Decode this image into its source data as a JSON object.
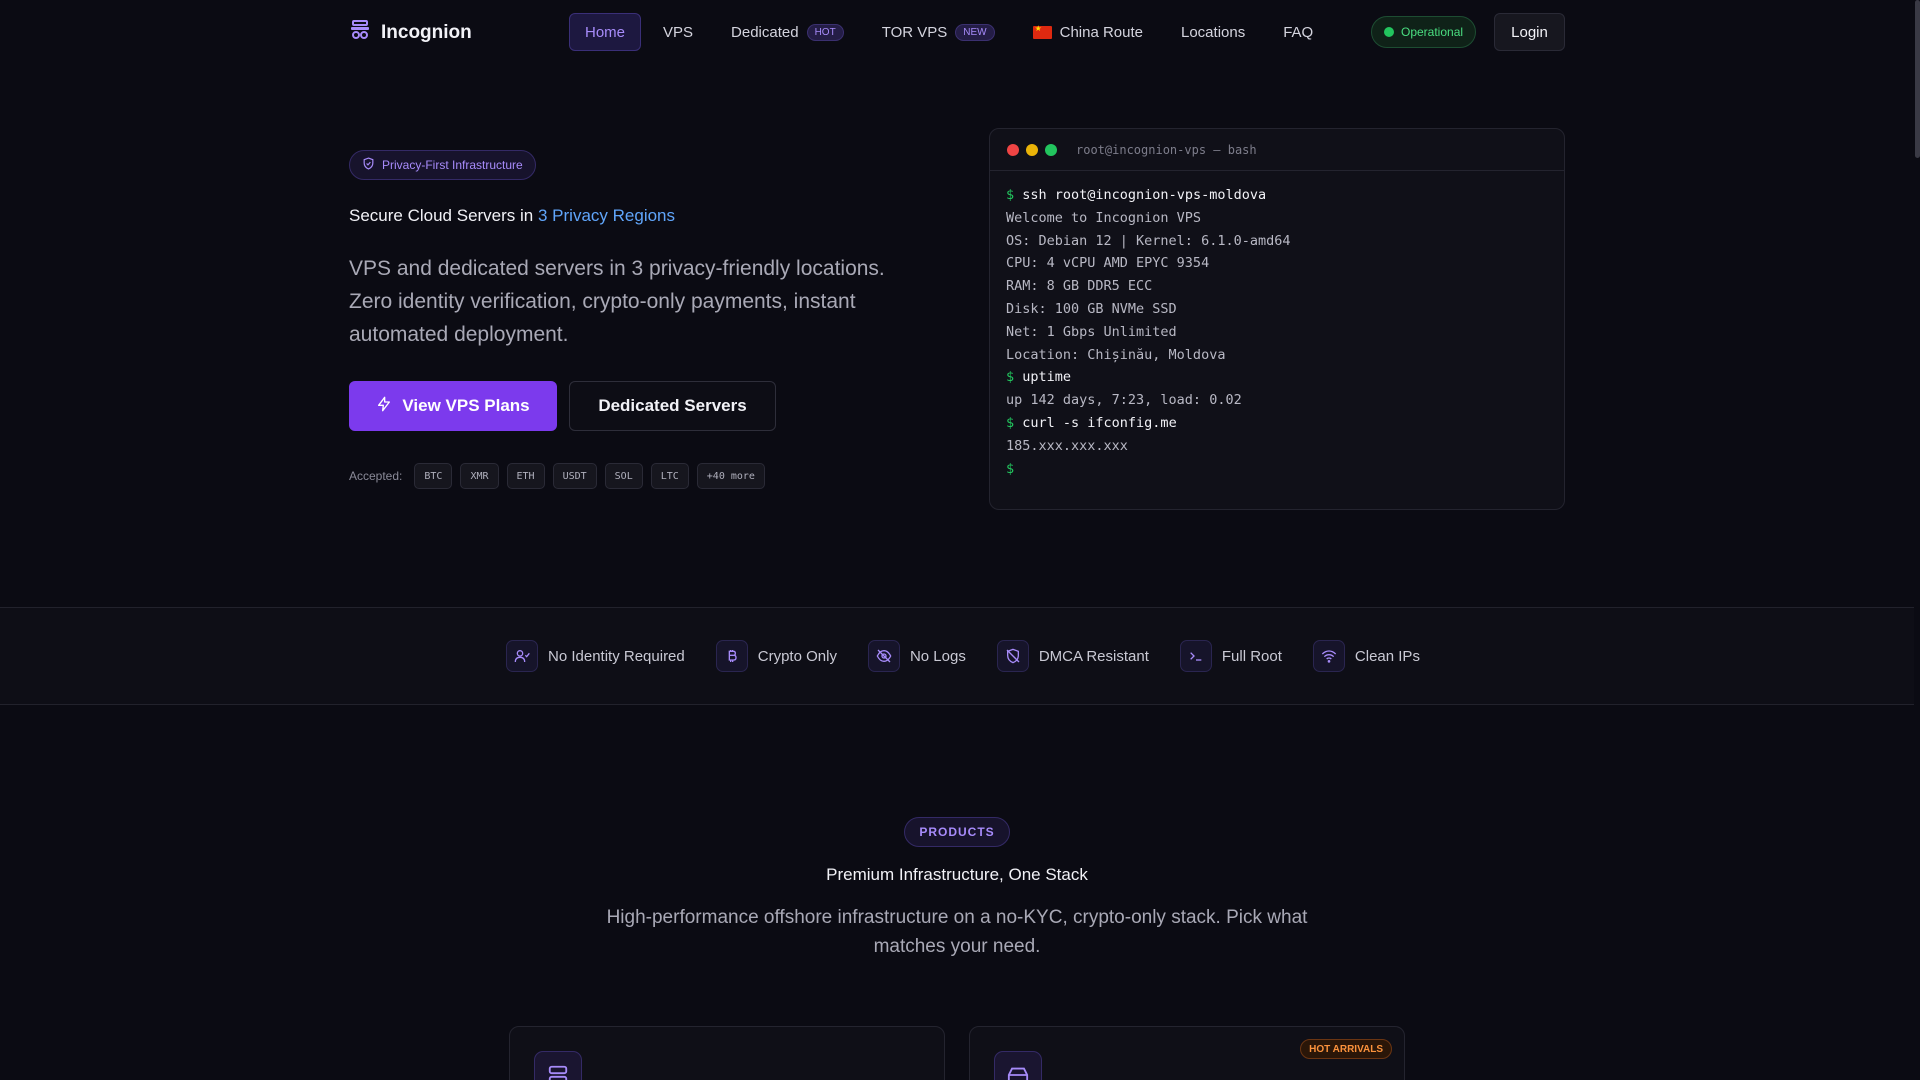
{
  "brand": {
    "name": "Incognion"
  },
  "nav": {
    "items": [
      {
        "label": "Home",
        "active": true
      },
      {
        "label": "VPS"
      },
      {
        "label": "Dedicated",
        "badge": "HOT"
      },
      {
        "label": "TOR VPS",
        "badge": "NEW"
      },
      {
        "label": "China Route",
        "flag": "CN"
      },
      {
        "label": "Locations"
      },
      {
        "label": "FAQ"
      }
    ],
    "status": "Operational",
    "login": "Login"
  },
  "hero": {
    "pill": "Privacy-First Infrastructure",
    "title_prefix": "Secure Cloud Servers in",
    "title_highlight": "3 Privacy Regions",
    "description": "VPS and dedicated servers in 3 privacy-friendly locations. Zero identity verification, crypto-only payments, instant automated deployment.",
    "primary_button": "View VPS Plans",
    "secondary_button": "Dedicated Servers",
    "accepted_label": "Accepted:",
    "coins": [
      "BTC",
      "XMR",
      "ETH",
      "USDT",
      "SOL",
      "LTC",
      "+40 more"
    ]
  },
  "terminal": {
    "title": "root@incognion-vps — bash",
    "lines": [
      {
        "type": "cmd",
        "text": "ssh root@incognion-vps-moldova"
      },
      {
        "type": "out",
        "text": "Welcome to Incognion VPS"
      },
      {
        "type": "out",
        "text": "OS: Debian 12 | Kernel: 6.1.0-amd64"
      },
      {
        "type": "out",
        "text": "CPU: 4 vCPU AMD EPYC 9354"
      },
      {
        "type": "out",
        "text": "RAM: 8 GB DDR5 ECC"
      },
      {
        "type": "out",
        "text": "Disk: 100 GB NVMe SSD"
      },
      {
        "type": "out",
        "text": "Net: 1 Gbps Unlimited"
      },
      {
        "type": "out",
        "text": "Location: Chișinău, Moldova"
      },
      {
        "type": "cmd",
        "text": "uptime"
      },
      {
        "type": "out",
        "text": "up 142 days, 7:23, load: 0.02"
      },
      {
        "type": "cmd",
        "text": "curl -s ifconfig.me"
      },
      {
        "type": "out",
        "text": "185.xxx.xxx.xxx"
      },
      {
        "type": "cmd",
        "text": ""
      }
    ]
  },
  "features": [
    {
      "label": "No Identity Required",
      "icon": "user-check-icon"
    },
    {
      "label": "Crypto Only",
      "icon": "bitcoin-icon"
    },
    {
      "label": "No Logs",
      "icon": "eye-off-icon"
    },
    {
      "label": "DMCA Resistant",
      "icon": "shield-off-icon"
    },
    {
      "label": "Full Root",
      "icon": "terminal-icon"
    },
    {
      "label": "Clean IPs",
      "icon": "wifi-icon"
    }
  ],
  "products": {
    "pill": "PRODUCTS",
    "title": "Premium Infrastructure, One Stack",
    "description": "High-performance offshore infrastructure on a no-KYC, crypto-only stack. Pick what matches your need.",
    "cards": [
      {
        "icon": "server-icon"
      },
      {
        "icon": "hard-drive-icon",
        "badge": "HOT ARRIVALS"
      }
    ]
  },
  "colors": {
    "accent": "#7c3aed",
    "accent_text": "#a78bfa",
    "highlight": "#60a5fa",
    "status": "#22c55e",
    "background": "#0b0b13"
  }
}
